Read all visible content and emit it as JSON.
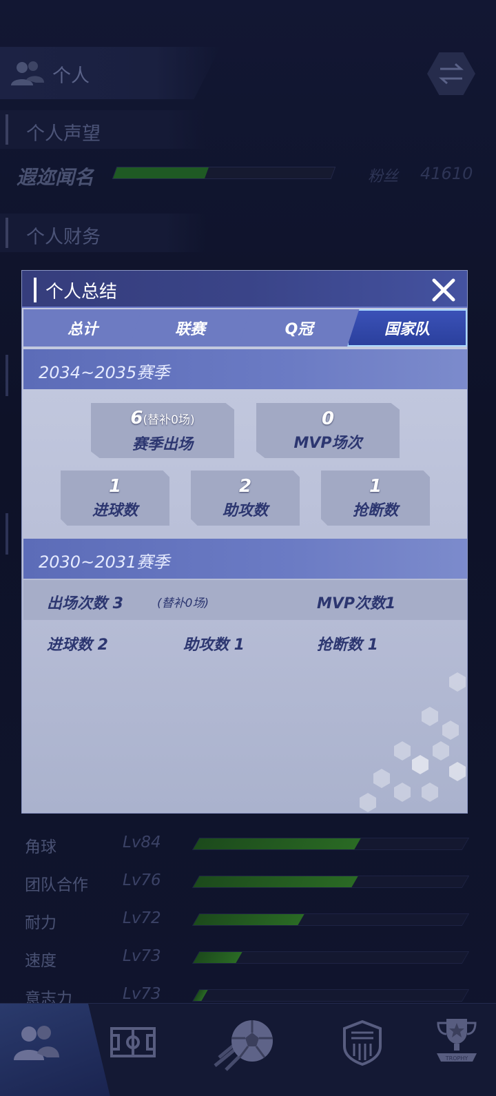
{
  "background": {
    "header_title": "个人",
    "reputation_section": "个人声望",
    "rank_title": "遐迩闻名",
    "rank_progress": 0.42,
    "fans_label": "粉丝",
    "fans_value": "41610",
    "finance_section": "个人财务",
    "skills": [
      {
        "name": "角球",
        "level": "Lv84",
        "progress": 0.6
      },
      {
        "name": "团队合作",
        "level": "Lv76",
        "progress": 0.59
      },
      {
        "name": "耐力",
        "level": "Lv72",
        "progress": 0.39
      },
      {
        "name": "速度",
        "level": "Lv73",
        "progress": 0.16
      },
      {
        "name": "意志力",
        "level": "Lv73",
        "progress": 0.03
      }
    ],
    "nav_icons": [
      "people-icon",
      "field-icon",
      "football-icon",
      "club-badge-icon",
      "trophy-icon"
    ],
    "nav_trophy_text": "TROPHY"
  },
  "modal": {
    "title": "个人总结",
    "tabs": [
      "总计",
      "联赛",
      "Q冠",
      "国家队"
    ],
    "active_tab": "国家队",
    "season_current": {
      "label": "2034~2035赛季",
      "appearances": {
        "value": "6",
        "sub": "(替补0场)",
        "label": "赛季出场"
      },
      "mvp": {
        "value": "0",
        "label": "MVP场次"
      },
      "goals": {
        "value": "1",
        "label": "进球数"
      },
      "assists": {
        "value": "2",
        "label": "助攻数"
      },
      "tackles": {
        "value": "1",
        "label": "抢断数"
      }
    },
    "season_past": {
      "label": "2030~2031赛季",
      "appearances": "出场次数 3",
      "substitutes": "(替补0场)",
      "mvp": "MVP次数1",
      "goals": "进球数 2",
      "assists": "助攻数 1",
      "tackles": "抢断数 1"
    }
  },
  "colors": {
    "accent": "#2a3f9c",
    "modal_bg": "#c7cde2",
    "season_bar": "#6b7bc4",
    "label_text": "#2c3670"
  }
}
